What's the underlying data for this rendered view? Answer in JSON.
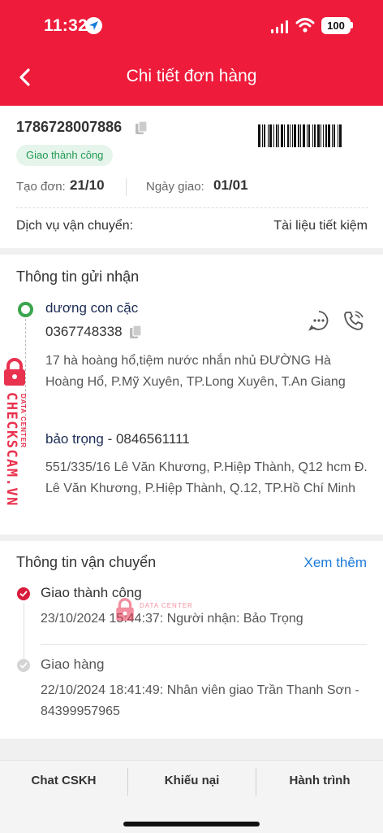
{
  "status_bar": {
    "time": "11:32",
    "battery": "100"
  },
  "header": {
    "title": "Chi tiết đơn hàng"
  },
  "order": {
    "id": "1786728007886",
    "status": "Giao thành công",
    "created_label": "Tạo đơn:",
    "created_value": "21/10",
    "delivery_label": "Ngày giao:",
    "delivery_value": "01/01",
    "service_label": "Dịch vụ vận chuyển:",
    "service_value": "Tài liệu tiết kiệm"
  },
  "sender_receiver": {
    "title": "Thông tin gửi nhận",
    "sender_name": "dương con cặc",
    "sender_phone": "0367748338",
    "sender_address": "17 hà hoàng hổ,tiệm nước nhắn nhủ ĐƯỜNG Hà Hoàng Hổ, P.Mỹ Xuyên, TP.Long Xuyên, T.An Giang",
    "receiver_name": "bảo trọng",
    "receiver_phone": " - 0846561111",
    "receiver_address": "551/335/16 Lê Văn Khương, P.Hiệp Thành, Q12 hcm Đ. Lê Văn Khương, P.Hiệp Thành, Q.12, TP.Hồ Chí Minh"
  },
  "shipping": {
    "title": "Thông tin vận chuyển",
    "see_more": "Xem thêm",
    "steps": [
      {
        "title": "Giao thành công",
        "desc": "23/10/2024 15:44:37: Người nhận: Bảo Trọng",
        "active": true
      },
      {
        "title": "Giao hàng",
        "desc": "22/10/2024 18:41:49: Nhân viên giao Trần Thanh Sơn - 84399957965",
        "active": false
      }
    ]
  },
  "bottom_bar": {
    "chat": "Chat CSKH",
    "complaint": "Khiếu nại",
    "journey": "Hành trình"
  },
  "watermark": {
    "side_text": "CHECKSCAM.VN",
    "side_small": "DATA CENTER",
    "center_small": "DATA CENTER"
  },
  "colors": {
    "brand_red": "#ee1b3a",
    "success_green": "#1f9a50",
    "link_blue": "#1a7ad9"
  }
}
